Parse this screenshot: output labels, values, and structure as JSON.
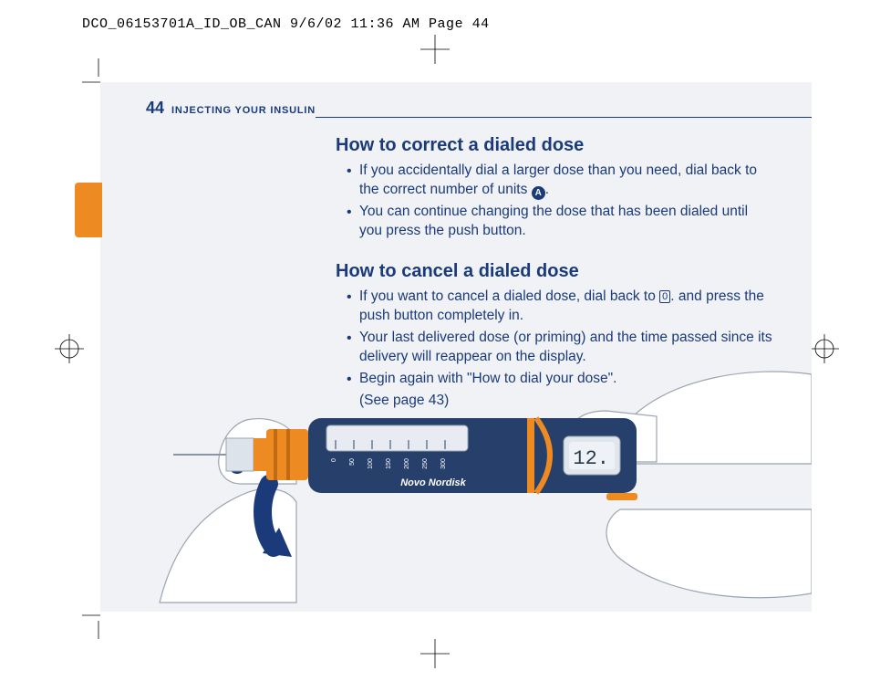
{
  "slug": "DCO_06153701A_ID_OB_CAN  9/6/02  11:36 AM  Page 44",
  "header": {
    "page_number": "44",
    "section": "INJECTING YOUR INSULIN"
  },
  "section1": {
    "title": "How to correct a dialed dose",
    "bullets": [
      "If you accidentally dial a larger dose than you need, dial back to the correct number of units",
      "You can continue changing the dose that has been dialed until you press the push button."
    ],
    "badge_a": "A"
  },
  "section2": {
    "title": "How to cancel a dialed dose",
    "bullets": [
      "If you want to cancel a dialed dose, dial back to",
      "Your last delivered dose (or priming) and the time passed since its delivery will reappear on the display.",
      "Begin again with \"How to dial your dose\"."
    ],
    "bullet1_cont": "and press the push button completely in.",
    "zero_glyph": "0",
    "see_page": "(See page 43)"
  },
  "illustration": {
    "callout_a": "A",
    "brand": "Novo Nordisk",
    "display_value": "12.",
    "scale": [
      "0",
      "50",
      "100",
      "150",
      "200",
      "250",
      "300"
    ]
  }
}
